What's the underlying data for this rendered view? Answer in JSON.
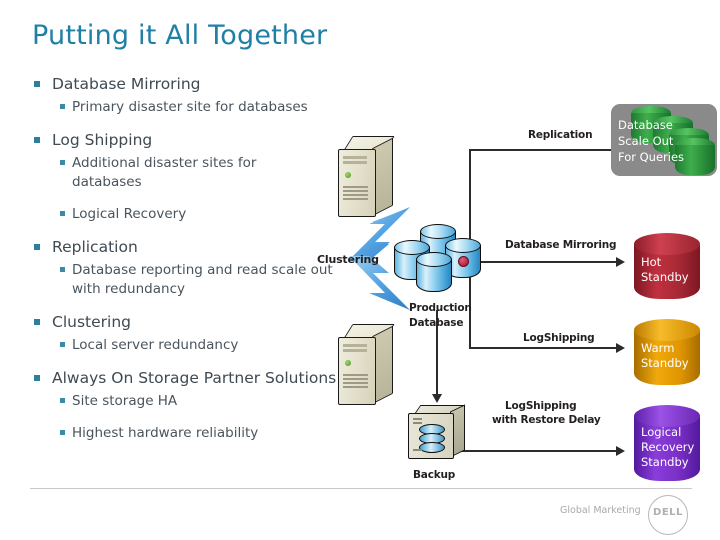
{
  "slide": {
    "title": "Putting it All Together"
  },
  "bullets": [
    {
      "level": 1,
      "text": "Database Mirroring"
    },
    {
      "level": 2,
      "text": "Primary disaster site for databases"
    },
    {
      "level": 1,
      "text": "Log Shipping"
    },
    {
      "level": 2,
      "text": "Additional disaster sites for databases"
    },
    {
      "level": 2,
      "text": "Logical Recovery"
    },
    {
      "level": 1,
      "text": "Replication"
    },
    {
      "level": 2,
      "text": "Database reporting and read scale out with redundancy"
    },
    {
      "level": 1,
      "text": "Clustering"
    },
    {
      "level": 2,
      "text": "Local server redundancy"
    },
    {
      "level": 1,
      "text": "Always On Storage Partner Solutions"
    },
    {
      "level": 2,
      "text": "Site storage HA"
    },
    {
      "level": 2,
      "text": "Highest hardware reliability"
    }
  ],
  "diagram": {
    "labels": {
      "clustering": "Clustering",
      "production_database": "Production\nDatabase",
      "production_database_l1": "Production",
      "production_database_l2": "Database",
      "backup": "Backup",
      "replication": "Replication",
      "database_mirroring": "Database Mirroring",
      "log_shipping": "LogShipping",
      "log_shipping_delay_l1": "LogShipping",
      "log_shipping_delay_l2": "with Restore Delay"
    },
    "nodes": {
      "scale_out": {
        "text_l1": "Database",
        "text_l2": "Scale Out",
        "text_l3": "For Queries",
        "color": "#2e9440",
        "panel_color": "#8a8a8a"
      },
      "hot_standby": {
        "text_l1": "Hot",
        "text_l2": "Standby",
        "color": "#a52834"
      },
      "warm_standby": {
        "text_l1": "Warm",
        "text_l2": "Standby",
        "color": "#e09600"
      },
      "logical_recovery_standby": {
        "text_l1": "Logical",
        "text_l2": "Recovery",
        "text_l3": "Standby",
        "color": "#7a2fc4"
      }
    }
  },
  "footer": {
    "credit": "Global Marketing",
    "logo": "DELL"
  },
  "theme": {
    "title_color": "#1f7fa5",
    "bullet_color": "#2e7e9e",
    "body_text_color": "#3f4a52",
    "rule_color": "#c9c9c9"
  }
}
